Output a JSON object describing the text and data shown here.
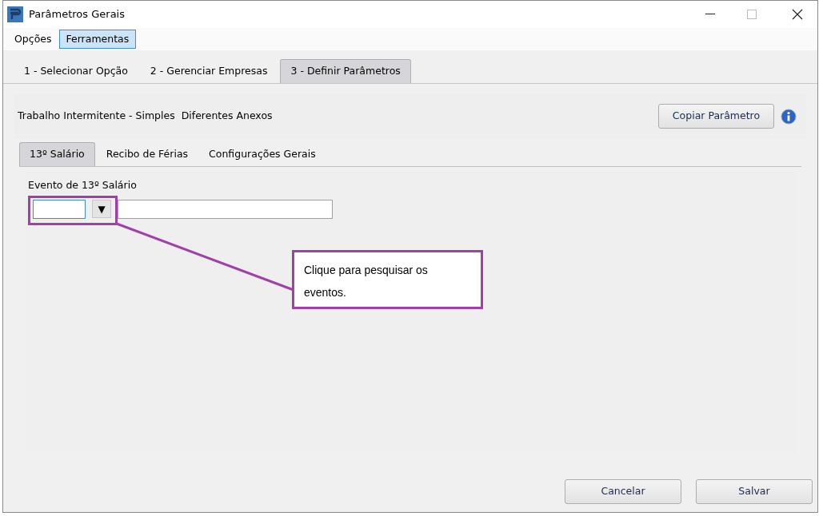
{
  "window": {
    "title": "Parâmetros Gerais"
  },
  "menu": [
    {
      "label": "Opções",
      "selected": false
    },
    {
      "label": "Ferramentas",
      "selected": true
    }
  ],
  "steps": [
    {
      "label": "1 - Selecionar Opção",
      "selected": false
    },
    {
      "label": "2 - Gerenciar Empresas",
      "selected": false
    },
    {
      "label": "3 - Definir Parâmetros",
      "selected": true
    }
  ],
  "header": {
    "title": "Trabalho Intermitente - Simples  Diferentes Anexos",
    "button": "Copiar Parâmetro"
  },
  "tabs": [
    {
      "label": "13º Salário",
      "selected": true
    },
    {
      "label": "Recibo de Férias",
      "selected": false
    },
    {
      "label": "Configurações Gerais",
      "selected": false
    }
  ],
  "field": {
    "label": "Evento de 13º Salário",
    "dropdown": "▼"
  },
  "callout": {
    "text": "Clique para pesquisar os eventos."
  },
  "buttons": [
    "Cancelar",
    "Salvar"
  ]
}
